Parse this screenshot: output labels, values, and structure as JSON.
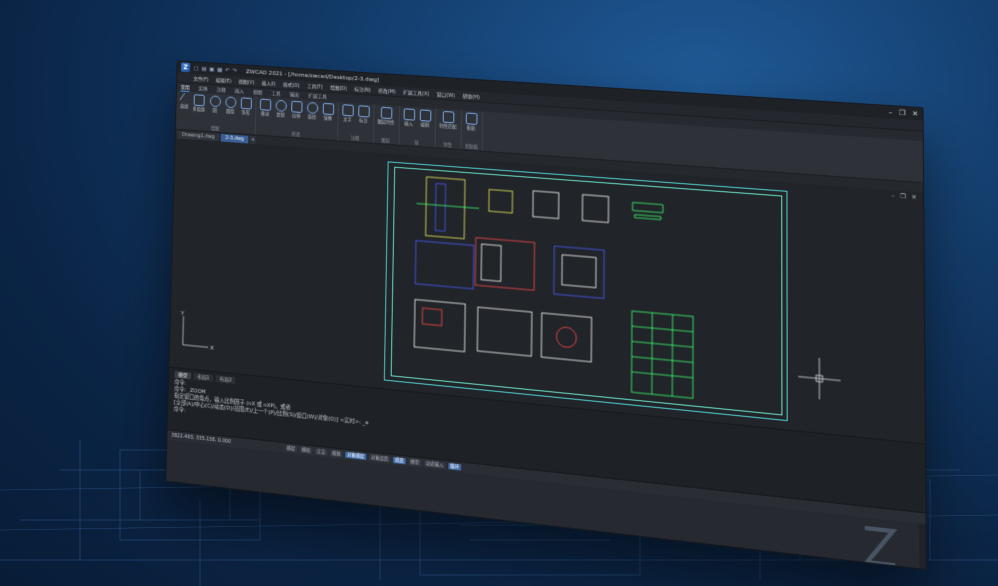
{
  "app": {
    "title": "ZWCAD 2021 - [/home/zwcad/Desktop/2-3.dwg]",
    "quick_access_icons": [
      "new-icon",
      "open-icon",
      "save-icon",
      "print-icon",
      "undo-icon",
      "redo-icon"
    ]
  },
  "menu": [
    "文件(F)",
    "编辑(E)",
    "视图(V)",
    "插入(I)",
    "格式(O)",
    "工具(T)",
    "绘图(D)",
    "标注(N)",
    "修改(M)",
    "扩展工具(X)",
    "窗口(W)",
    "帮助(H)"
  ],
  "ribbon": {
    "tabs": [
      "常用",
      "实体",
      "注释",
      "插入",
      "视图",
      "工具",
      "输出",
      "扩展工具"
    ],
    "active_tab": "常用",
    "groups": [
      {
        "name": "绘图",
        "tools": [
          "直线",
          "多段线",
          "圆",
          "圆弧",
          "矩形"
        ]
      },
      {
        "name": "修改",
        "tools": [
          "移动",
          "复制",
          "拉伸",
          "旋转",
          "镜像"
        ]
      },
      {
        "name": "注释",
        "tools": [
          "文字",
          "标注"
        ]
      },
      {
        "name": "图层",
        "tools": [
          "图层特性"
        ]
      },
      {
        "name": "块",
        "tools": [
          "插入",
          "编辑"
        ]
      },
      {
        "name": "特性",
        "tools": [
          "特性匹配"
        ]
      },
      {
        "name": "剪贴板",
        "tools": [
          "粘贴"
        ]
      }
    ]
  },
  "doc_tabs": [
    {
      "label": "Drawing1.dwg",
      "active": false
    },
    {
      "label": "2-3.dwg",
      "active": true
    }
  ],
  "command_line": {
    "tabs": [
      "模型",
      "布局1",
      "布局2"
    ],
    "lines": [
      "命令:",
      "命令: _ZOOM",
      "指定窗口的角点，输入比例因子 (nX 或 nXP)，或者",
      "[全部(A)/中心(C)/动态(D)/范围(E)/上一个(P)/比例(S)/窗口(W)/对象(O)] <实时>: _e",
      "命令:"
    ]
  },
  "status": {
    "coords": "3822.493, 335.138, 0.000",
    "buttons": [
      {
        "label": "捕捉",
        "on": false
      },
      {
        "label": "栅格",
        "on": false
      },
      {
        "label": "正交",
        "on": false
      },
      {
        "label": "极轴",
        "on": false
      },
      {
        "label": "对象捕捉",
        "on": true
      },
      {
        "label": "对象追踪",
        "on": false
      },
      {
        "label": "线宽",
        "on": true
      },
      {
        "label": "模型",
        "on": false
      },
      {
        "label": "动态输入",
        "on": false
      },
      {
        "label": "循环",
        "on": true
      }
    ]
  },
  "colors": {
    "accent": "#3f6aa8",
    "canvas": "#212429",
    "cad_green": "#3cff6e",
    "cad_yellow": "#f3f35a",
    "cad_cyan": "#4fd0d0",
    "cad_blue": "#4a5cff",
    "cad_red": "#ff4a4a"
  }
}
